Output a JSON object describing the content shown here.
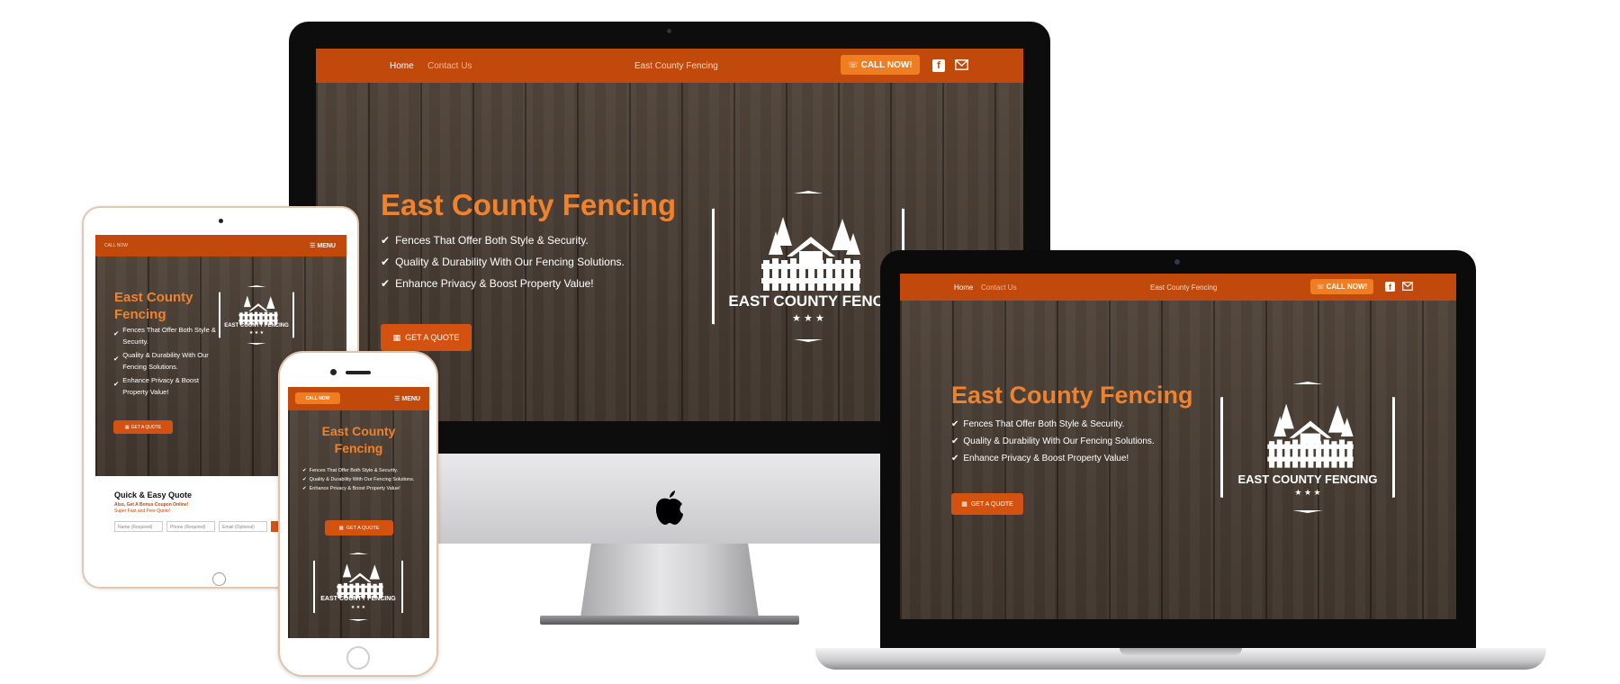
{
  "brand": {
    "site_name": "East County Fencing",
    "headline": "East County Fencing",
    "logo_line": "EAST COUNTY FENCING",
    "logo_line_desktop": "EAST COUNTY FENCI",
    "accent_color": "#f0822d",
    "bar_color": "#c0490b"
  },
  "nav": {
    "home": "Home",
    "contact": "Contact Us",
    "call": "CALL NOW!",
    "call_short": "CALL NOW",
    "menu": "MENU",
    "icons": [
      "phone-icon",
      "facebook-icon",
      "mail-icon"
    ]
  },
  "hero": {
    "features": [
      "Fences That Offer Both Style & Security.",
      "Quality & Durability With Our Fencing Solutions.",
      "Enhance Privacy & Boost Property Value!"
    ],
    "cta": "GET A QUOTE"
  },
  "ipad": {
    "features": [
      "Fences That Offer Both Style & Security.",
      "Quality & Durability With Our Fencing Solutions.",
      "Enhance Privacy & Boost Property Value!"
    ],
    "quote_title": "Quick & Easy Quote",
    "quote_sub": "Also, Get A Bonus Coupon Online!",
    "quote_sub2": "Super Fast and Free Quote!",
    "fields": [
      "Name (Required)",
      "Phone (Required)",
      "Email (Optional)"
    ]
  }
}
